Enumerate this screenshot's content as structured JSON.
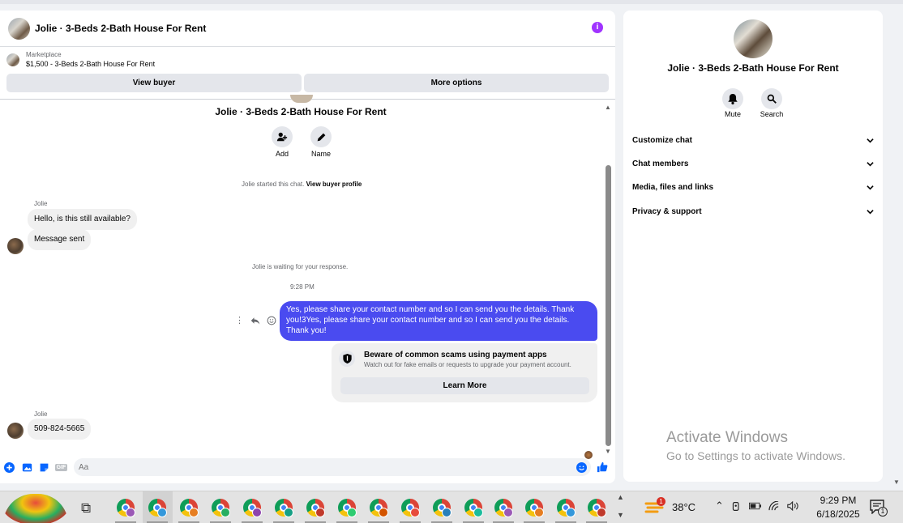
{
  "chat": {
    "header_title": "Jolie · 3-Beds 2-Bath House For Rent",
    "info_icon": "i",
    "marketplace_label": "Marketplace",
    "listing_line": "$1,500 - 3-Beds 2-Bath House For Rent",
    "view_buyer": "View buyer",
    "more_options": "More options",
    "conversation_title": "Jolie · 3-Beds 2-Bath House For Rent",
    "add_label": "Add",
    "name_label": "Name",
    "started_text": "Jolie started this chat.",
    "view_profile_link": "View buyer profile",
    "sender_name": "Jolie",
    "msg_in_1": "Hello, is this still available?",
    "msg_in_2": "Message sent",
    "waiting_text": "Jolie is waiting for your response.",
    "time_stamp": "9:28 PM",
    "msg_out": "Yes, please share your contact number and so I can send you the details. Thank you!3Yes, please share your contact number and so I can send you the details. Thank you!",
    "warn_title": "Beware of common scams using payment apps",
    "warn_sub": "Watch out for fake emails or requests to upgrade your payment account.",
    "learn_more": "Learn More",
    "sender_name_2": "Jolie",
    "msg_in_3": "509-824-5665",
    "input_placeholder": "Aa",
    "gif_label": "GIF"
  },
  "side": {
    "title": "Jolie · 3-Beds 2-Bath House For Rent",
    "mute": "Mute",
    "search": "Search",
    "rows": [
      "Customize chat",
      "Chat members",
      "Media, files and links",
      "Privacy & support"
    ]
  },
  "watermark": {
    "line1": "Activate Windows",
    "line2": "Go to Settings to activate Windows."
  },
  "taskbar": {
    "temperature": "38°C",
    "weather_badge": "1",
    "time": "9:29 PM",
    "date": "6/18/2025",
    "notification_count": "1"
  },
  "colors": {
    "accent": "#4a4bf0",
    "info": "#a033ff",
    "like": "#0866ff"
  }
}
